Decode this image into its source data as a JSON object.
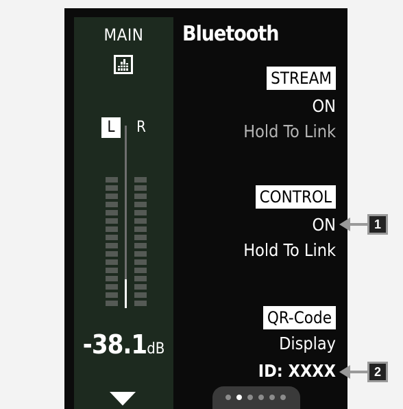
{
  "meter": {
    "main_label": "MAIN",
    "left_channel": "L",
    "right_channel": "R",
    "db_value": "-38.1",
    "db_unit": "dB"
  },
  "panel": {
    "title": "Bluetooth",
    "stream": {
      "label": "STREAM",
      "state": "ON",
      "action": "Hold To Link"
    },
    "control": {
      "label": "CONTROL",
      "state": "ON",
      "action": "Hold To Link"
    },
    "qr": {
      "label": "QR-Code",
      "action": "Display",
      "id": "ID:  XXXX"
    }
  },
  "pager": {
    "pages": 6,
    "active_index": 1
  },
  "callouts": [
    "1",
    "2"
  ]
}
